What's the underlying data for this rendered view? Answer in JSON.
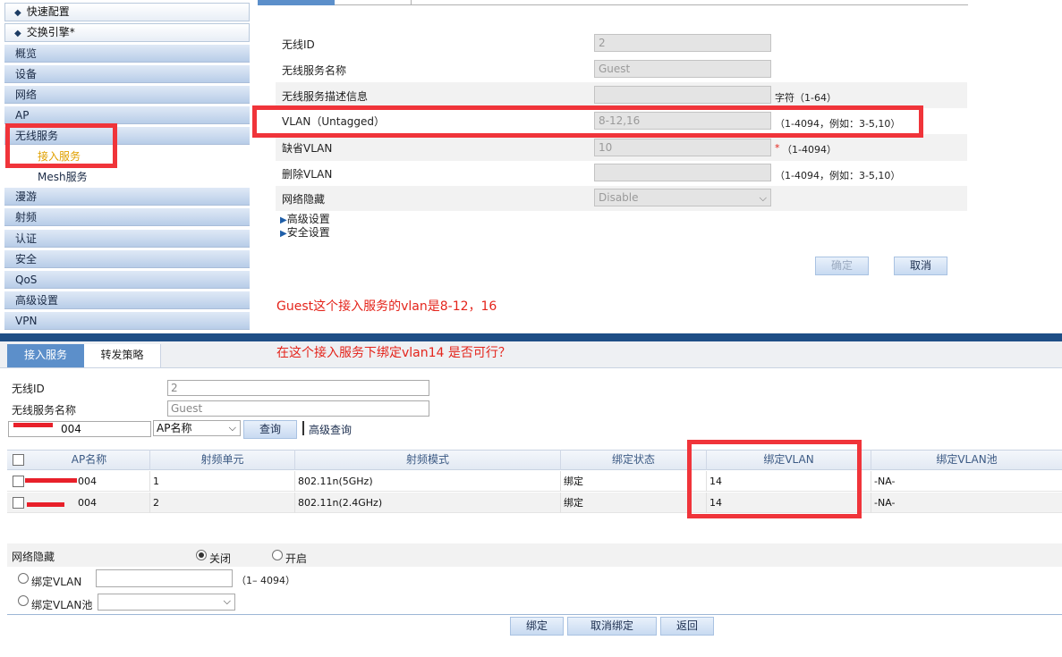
{
  "sidebar": {
    "headers": [
      "快速配置",
      "交换引擎*"
    ],
    "items": [
      "概览",
      "设备",
      "网络",
      "AP",
      "无线服务",
      "漫游",
      "射频",
      "认证",
      "安全",
      "QoS",
      "高级设置",
      "VPN"
    ],
    "sub_items": [
      "接入服务",
      "Mesh服务"
    ],
    "active_sub": "接入服务"
  },
  "top_form": {
    "fields": [
      {
        "label": "无线ID",
        "value": "2",
        "hint": ""
      },
      {
        "label": "无线服务名称",
        "value": "Guest",
        "hint": ""
      },
      {
        "label": "无线服务描述信息",
        "value": "",
        "hint": "字符（1-64）"
      },
      {
        "label": "VLAN（Untagged）",
        "value": "8-12,16",
        "hint": "（1-4094，例如：3-5,10）"
      },
      {
        "label": "缺省VLAN",
        "value": "10",
        "hint": "（1-4094）",
        "required_mark": "*"
      },
      {
        "label": "删除VLAN",
        "value": "",
        "hint": "（1-4094，例如：3-5,10）"
      },
      {
        "label": "网络隐藏",
        "value": "Disable",
        "hint": ""
      }
    ],
    "expanders": [
      "高级设置",
      "安全设置"
    ],
    "confirm_label": "确定",
    "cancel_label": "取消"
  },
  "annotations": {
    "note1": "Guest这个接入服务的vlan是8-12，16",
    "note2": "在这个接入服务下绑定vlan14 是否可行？"
  },
  "bottom": {
    "tabs": [
      "接入服务",
      "转发策略"
    ],
    "wireless_id_label": "无线ID",
    "wireless_id_value": "2",
    "service_name_label": "无线服务名称",
    "service_name_value": "Guest",
    "search_value_suffix": "004",
    "search_field_select": "AP名称",
    "search_button": "查询",
    "advanced_search": "高级查询",
    "table": {
      "headers": [
        "AP名称",
        "射频单元",
        "射频模式",
        "绑定状态",
        "绑定VLAN",
        "绑定VLAN池"
      ],
      "rows": [
        {
          "ap": "004",
          "radio": "1",
          "mode": "802.11n(5GHz)",
          "status": "绑定",
          "vlan": "14",
          "pool": "-NA-"
        },
        {
          "ap": "004",
          "radio": "2",
          "mode": "802.11n(2.4GHz)",
          "status": "绑定",
          "vlan": "14",
          "pool": "-NA-"
        }
      ]
    },
    "hide_label": "网络隐藏",
    "hide_off": "关闭",
    "hide_on": "开启",
    "bind_vlan_label": "绑定VLAN",
    "bind_vlan_hint": "（1– 4094）",
    "bind_pool_label": "绑定VLAN池",
    "buttons": [
      "绑定",
      "取消绑定",
      "返回"
    ]
  },
  "colors": {
    "accent_dark": "#1e4e86",
    "annotation_red": "#f0343a",
    "sidebar_active": "#e0a000"
  }
}
